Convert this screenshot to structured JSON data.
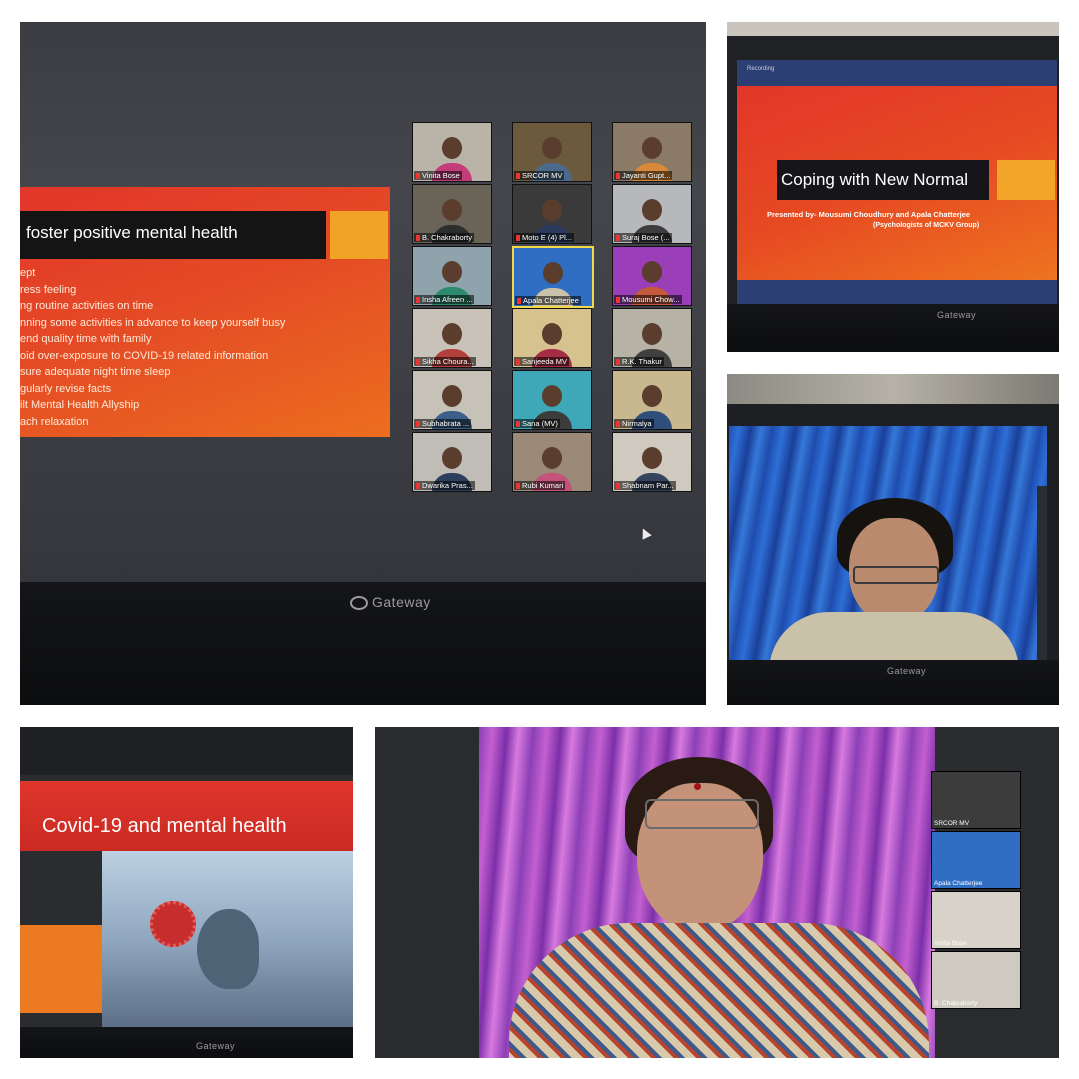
{
  "photo1": {
    "slide": {
      "title": "foster positive mental health",
      "bullets": [
        "ept",
        "ress feeling",
        "ng routine activities on time",
        "nning some activities in advance to keep yourself busy",
        "end quality time with family",
        "oid over-exposure to COVID-19 related information",
        "sure adequate night time sleep",
        "gularly revise facts",
        "ilt Mental Health Allyship",
        "ach relaxation"
      ]
    },
    "participants": [
      {
        "name": "Vinita Bose",
        "bg": "#b9b3a8",
        "shirt": "#c43c7a"
      },
      {
        "name": "SRCOR MV",
        "bg": "#6b5a3c",
        "shirt": "#4c6a8c"
      },
      {
        "name": "Jayanti  Gupt...",
        "bg": "#8a7a66",
        "shirt": "#d88a3a"
      },
      {
        "name": "B. Chakraborty",
        "bg": "#6a6358",
        "shirt": "#2d2d2d"
      },
      {
        "name": "Moto E (4) Pl...",
        "bg": "#3a3a3a",
        "shirt": "#2b3a5c"
      },
      {
        "name": "Suraj Bose (...",
        "bg": "#b6b8bc",
        "shirt": "#3d3d3d"
      },
      {
        "name": "Insha Afreen ...",
        "bg": "#8fa3ad",
        "shirt": "#2e8a6e"
      },
      {
        "name": "Apala Chatterjee",
        "bg": "#2f6ec2",
        "shirt": "#c9c1a8"
      },
      {
        "name": "Mousumi Chow...",
        "bg": "#9a3fb8",
        "shirt": "#c4593b"
      },
      {
        "name": "Sikha Choura...",
        "bg": "#c9c2b8",
        "shirt": "#b3403c"
      },
      {
        "name": "Sanjeeda MV",
        "bg": "#d6c28e",
        "shirt": "#a52d44"
      },
      {
        "name": "R.K. Thakur",
        "bg": "#b7b2a6",
        "shirt": "#3f3f3f"
      },
      {
        "name": "Subhabrata ...",
        "bg": "#c6c2b8",
        "shirt": "#3c5f8a"
      },
      {
        "name": "Sana (MV)",
        "bg": "#3fa8b8",
        "shirt": "#3c3c3c"
      },
      {
        "name": "Nirmalya",
        "bg": "#c8b890",
        "shirt": "#2f4e7a"
      },
      {
        "name": "Dwarika Pras...",
        "bg": "#c0bdb6",
        "shirt": "#2d3e5c"
      },
      {
        "name": "Rubi Kumari",
        "bg": "#9c8a78",
        "shirt": "#c4527a"
      },
      {
        "name": "Shabnam Par...",
        "bg": "#cfc9bf",
        "shirt": "#34445c"
      }
    ],
    "monitor_brand": "Gateway"
  },
  "photo2": {
    "recording_label": "Recording",
    "slide": {
      "title": "Coping with New Normal",
      "presenters": "Presented by- Mousumi Choudhury and Apala Chatterjee",
      "affiliation": "(Psychologists of MCKV Group)"
    },
    "monitor_brand": "Gateway"
  },
  "photo3": {
    "monitor_brand": "Gateway"
  },
  "photo4": {
    "slide": {
      "title": "Covid-19 and mental health"
    },
    "monitor_brand": "Gateway"
  },
  "photo5": {
    "participants": [
      {
        "name": "SRCOR MV",
        "bg": "#3c3c3c"
      },
      {
        "name": "Apala Chatterjee",
        "bg": "#2f6ec2"
      },
      {
        "name": "Vinita Bose",
        "bg": "#d8d2c8"
      },
      {
        "name": "B. Chakraborty",
        "bg": "#cfcac0"
      }
    ]
  }
}
